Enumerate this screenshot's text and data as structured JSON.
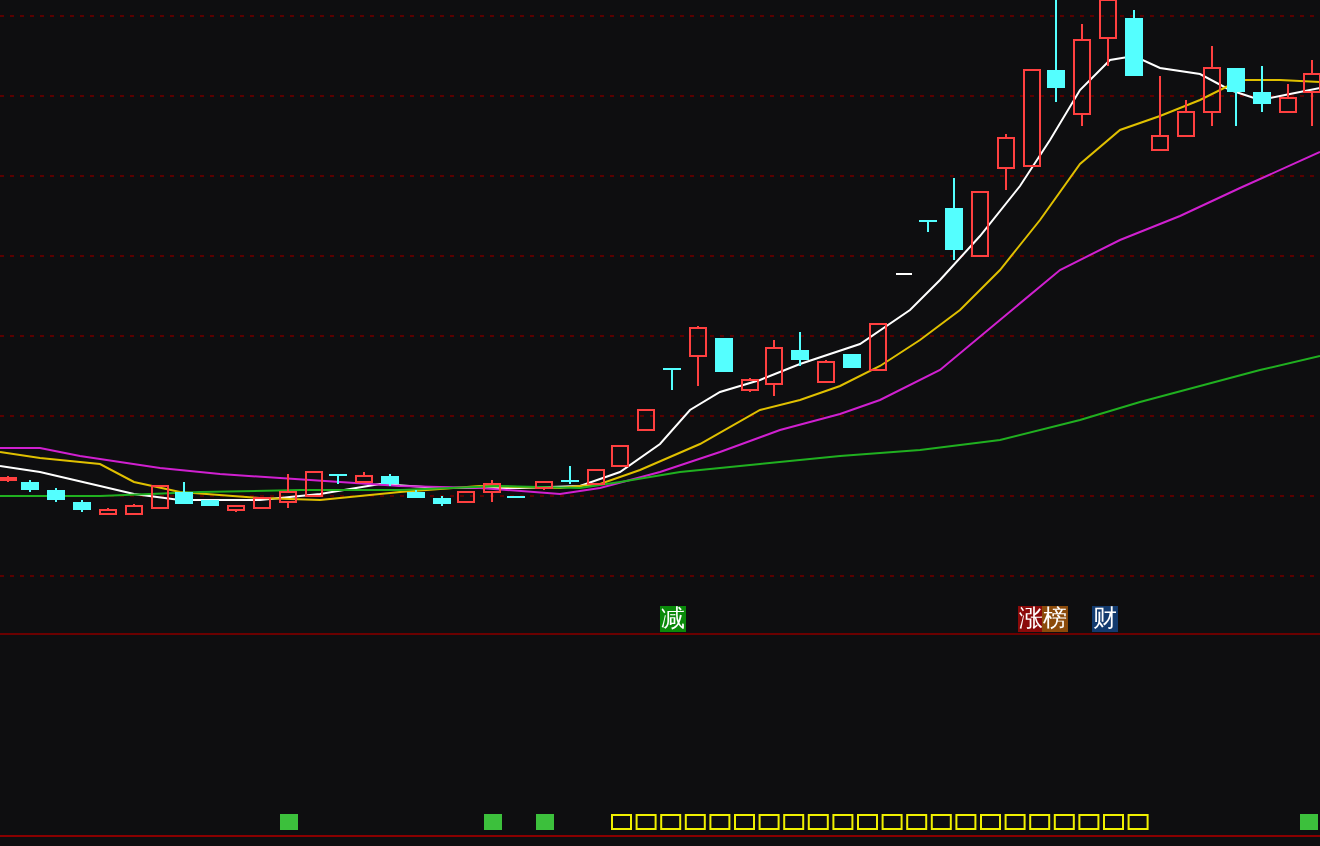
{
  "event_badges": [
    {
      "text": "减",
      "color": "#0a8a0a"
    },
    {
      "text": "涨",
      "color": "#8b0a0a"
    },
    {
      "text": "榜",
      "color": "#8b4a0a"
    },
    {
      "text": "财",
      "color": "#123a6e"
    }
  ]
}
